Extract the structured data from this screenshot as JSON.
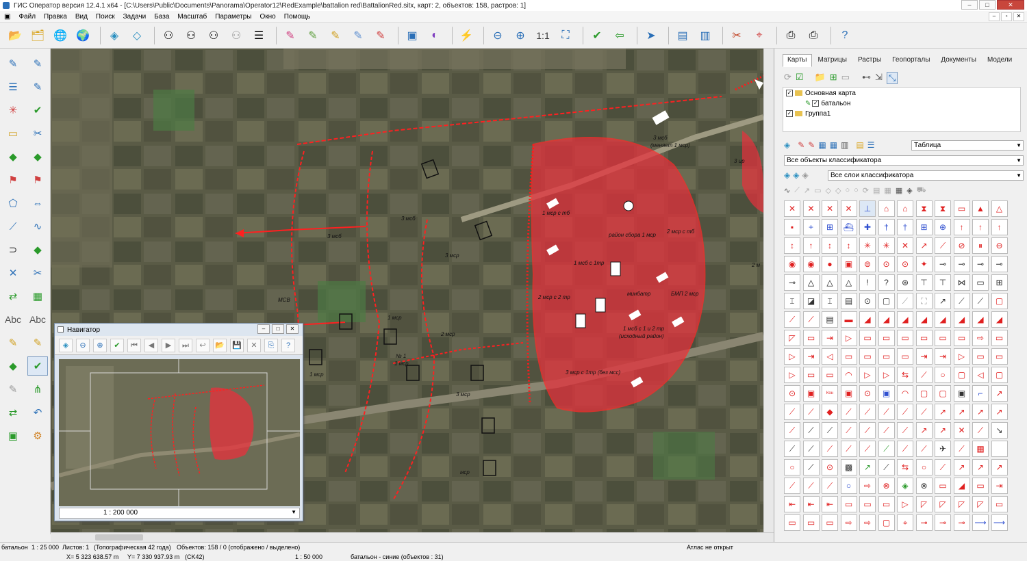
{
  "window": {
    "title": "ГИС Оператор версия 12.4.1 x64 - [C:\\Users\\Public\\Documents\\Panorama\\Operator12\\RedExample\\battalion red\\BattalionRed.sitx, карт: 2, объектов: 158, растров: 1]"
  },
  "menu": [
    "Файл",
    "Правка",
    "Вид",
    "Поиск",
    "Задачи",
    "База",
    "Масштаб",
    "Параметры",
    "Окно",
    "Помощь"
  ],
  "toolbar": {
    "scale_11": "1:1"
  },
  "left_tools": {
    "abc1": "Abc",
    "abc2": "Abc"
  },
  "map_labels": [
    {
      "text": "3 мсб"
    },
    {
      "text": "(меняет 1 мср)"
    },
    {
      "text": "1 мср с тб"
    },
    {
      "text": "район сбора 1 мср"
    },
    {
      "text": "2 мср с тб"
    },
    {
      "text": "1 мсб с 1тр"
    },
    {
      "text": "2 мср с 2 тр"
    },
    {
      "text": "минбатр"
    },
    {
      "text": "БМП 2 мср"
    },
    {
      "text": "1 мсб с 1 и 2 тр"
    },
    {
      "text": "(исходный район)"
    },
    {
      "text": "3 мср с 1тр (без мсс)"
    },
    {
      "text": "3 мсб"
    },
    {
      "text": "3 мсб"
    },
    {
      "text": "3 мср"
    },
    {
      "text": "МСВ"
    },
    {
      "text": "1 мср"
    },
    {
      "text": "2 мср"
    },
    {
      "text": "№ 1"
    },
    {
      "text": "1 мср"
    },
    {
      "text": "1 мср"
    },
    {
      "text": "3 мср"
    },
    {
      "text": "мср"
    },
    {
      "text": "3 ир"
    },
    {
      "text": "2 м"
    }
  ],
  "panel": {
    "tabs": [
      "Карты",
      "Матрицы",
      "Растры",
      "Геопорталы",
      "Документы",
      "Модели"
    ],
    "tree": {
      "item1": "Основная карта",
      "item2": "батальон",
      "item3": "Группа1"
    },
    "view_mode": "Таблица",
    "classifier_objects": "Все объекты классификатора",
    "classifier_layers": "Все слои классификатора"
  },
  "navigator": {
    "title": "Навигатор",
    "scale": "1 : 200 000"
  },
  "status": {
    "layer": "батальон",
    "scale": "1 : 25 000",
    "sheets": "Листов: 1",
    "type": "(Топографическая 42 года)",
    "objects": "Объектов: 158 / 0 (отображено / выделено)",
    "atlas": "Атлас не открыт",
    "x": "X= 5 323 638.57 m",
    "y": "Y= 7 330 937.93 m",
    "crs": "(CK42)",
    "scale2": "1 : 50 000",
    "selection": "батальон - синие   (объектов : 31)"
  },
  "colors": {
    "accent_red": "#e01e1e",
    "zone_fill": "#e8303c"
  }
}
